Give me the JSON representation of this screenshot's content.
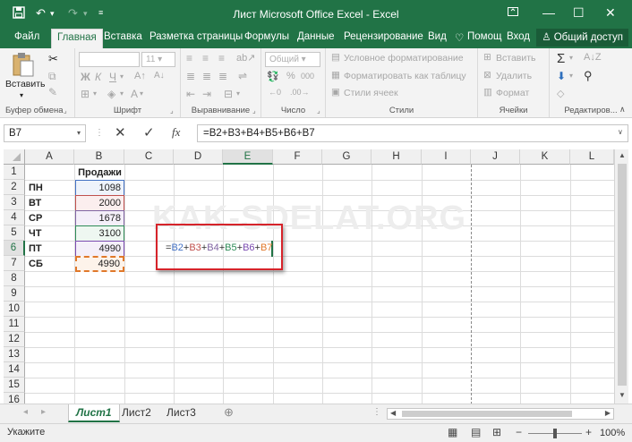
{
  "window": {
    "title": "Лист Microsoft Office Excel - Excel",
    "accent_color": "#217346",
    "controls": [
      "▢",
      "—",
      "☐",
      "✕"
    ]
  },
  "quick_access": {
    "save_icon": "save-icon",
    "undo_icon": "undo-icon",
    "redo_icon": "redo-icon",
    "customize_icon": "customize-icon"
  },
  "tabs": [
    "Файл",
    "Главная",
    "Вставка",
    "Разметка страницы",
    "Формулы",
    "Данные",
    "Рецензирование",
    "Вид",
    "Помощ",
    "Вход"
  ],
  "active_tab": "Главная",
  "share_label": "Общий доступ",
  "ribbon": {
    "clipboard": {
      "paste": "Вставить",
      "label": "Буфер обмена"
    },
    "font": {
      "name": "",
      "size": "11",
      "bold": "Ж",
      "italic": "К",
      "underline": "Ч",
      "label": "Шрифт"
    },
    "alignment": {
      "label": "Выравнивание"
    },
    "number": {
      "format": "Общий",
      "label": "Число",
      "percent": "%",
      "thousands": "000"
    },
    "styles": {
      "conditional": "Условное форматирование",
      "table": "Форматировать как таблицу",
      "cell_styles": "Стили ячеек",
      "label": "Стили"
    },
    "cells": {
      "insert": "Вставить",
      "delete": "Удалить",
      "format": "Формат",
      "label": "Ячейки"
    },
    "editing": {
      "label": "Редактиров..."
    }
  },
  "formula_bar": {
    "name_box": "B7",
    "cancel": "✕",
    "confirm": "✓",
    "fx": "fx",
    "formula": "=B2+B3+B4+B5+B6+B7"
  },
  "grid": {
    "columns": [
      "A",
      "B",
      "C",
      "D",
      "E",
      "F",
      "G",
      "H",
      "I",
      "J",
      "K",
      "L"
    ],
    "rows": [
      "1",
      "2",
      "3",
      "4",
      "5",
      "6",
      "7",
      "8",
      "9",
      "10",
      "11",
      "12",
      "13",
      "14",
      "15",
      "16"
    ],
    "header_b1": "Продажи",
    "days": [
      "ПН",
      "ВТ",
      "СР",
      "ЧТ",
      "ПТ",
      "СБ"
    ],
    "values": [
      "1098",
      "2000",
      "1678",
      "3100",
      "4990",
      "4990"
    ],
    "range_colors": [
      "#4472c4",
      "#c0504d",
      "#8064a2",
      "#2e8b57",
      "#7b4bb0",
      "#e0782a"
    ],
    "editing_cell": {
      "address": "E6",
      "tokens": [
        {
          "text": "=",
          "color": "#333333"
        },
        {
          "text": "B2",
          "color": "#4472c4"
        },
        {
          "text": "+",
          "color": "#333333"
        },
        {
          "text": "B3",
          "color": "#c0504d"
        },
        {
          "text": "+",
          "color": "#333333"
        },
        {
          "text": "B4",
          "color": "#8064a2"
        },
        {
          "text": "+",
          "color": "#333333"
        },
        {
          "text": "B5",
          "color": "#2e8b57"
        },
        {
          "text": "+",
          "color": "#333333"
        },
        {
          "text": "B6",
          "color": "#7b4bb0"
        },
        {
          "text": "+",
          "color": "#333333"
        },
        {
          "text": "B7",
          "color": "#e0782a"
        }
      ]
    },
    "watermark": "KAK-SDELAT.ORG"
  },
  "sheets": [
    "Лист1",
    "Лист2",
    "Лист3"
  ],
  "active_sheet": "Лист1",
  "status": {
    "mode": "Укажите",
    "zoom": "100%"
  }
}
